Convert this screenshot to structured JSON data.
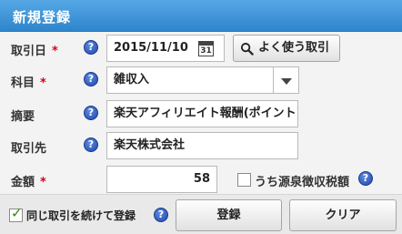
{
  "title": "新規登録",
  "fields": {
    "date": {
      "label": "取引日",
      "value": "2015/11/10",
      "calendar_day": "31"
    },
    "frequent_button": "よく使う取引",
    "subject": {
      "label": "科目",
      "value": "雑収入"
    },
    "summary": {
      "label": "摘要",
      "value": "楽天アフィリエイト報酬(ポイント)"
    },
    "partner": {
      "label": "取引先",
      "value": "楽天株式会社"
    },
    "amount": {
      "label": "金額",
      "value": "58",
      "withholding_label": "うち源泉徴収税額"
    }
  },
  "required_mark": "*",
  "help_symbol": "?",
  "footer": {
    "continue_label": "同じ取引を続けて登録",
    "register_button": "登録",
    "clear_button": "クリア"
  },
  "colors": {
    "header": "#3b91d6",
    "required": "#d0021b",
    "help": "#2a4fb5"
  },
  "icons": [
    "help-icon",
    "calendar-icon",
    "search-icon",
    "dropdown-arrow-icon",
    "checkbox-icon"
  ]
}
